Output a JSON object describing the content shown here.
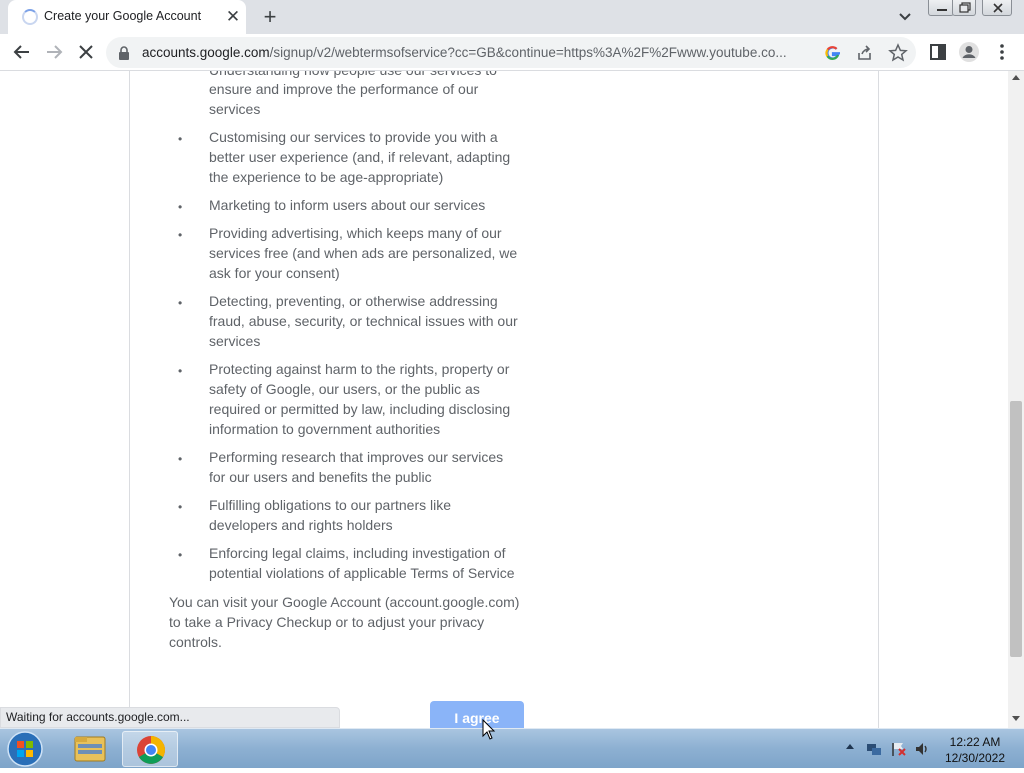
{
  "browser": {
    "tab_title": "Create your Google Account",
    "url_host": "accounts.google.com",
    "url_path": "/signup/v2/webtermsofservice?cc=GB&continue=https%3A%2F%2Fwww.youtube.co..."
  },
  "content": {
    "partial_top_line": "Understanding how people use our services to",
    "items": [
      {
        "lines": [
          "ensure and improve the performance of our",
          "services"
        ]
      },
      {
        "lines": [
          "Customising our services to provide you with a",
          "better user experience (and, if relevant, adapting",
          "the experience to be age-appropriate)"
        ]
      },
      {
        "lines": [
          "Marketing to inform users about our services"
        ]
      },
      {
        "lines": [
          "Providing advertising, which keeps many of our",
          "services free (and when ads are personalized, we",
          "ask for your consent)"
        ]
      },
      {
        "lines": [
          "Detecting, preventing, or otherwise addressing",
          "fraud, abuse, security, or technical issues with our",
          "services"
        ]
      },
      {
        "lines": [
          "Protecting against harm to the rights, property or",
          "safety of Google, our users, or the public as",
          "required or permitted by law, including disclosing",
          "information to government authorities"
        ]
      },
      {
        "lines": [
          "Performing research that improves our services",
          "for our users and benefits the public"
        ]
      },
      {
        "lines": [
          "Fulfilling obligations to our partners like",
          "developers and rights holders"
        ]
      },
      {
        "lines": [
          "Enforcing legal claims, including investigation of",
          "potential violations of applicable Terms of Service"
        ]
      }
    ],
    "privacy_lines": [
      "You can visit your Google Account (account.google.com)",
      "to take a Privacy Checkup or to adjust your privacy",
      "controls."
    ],
    "agree_label": "I agree"
  },
  "status": "Waiting for accounts.google.com...",
  "taskbar": {
    "time": "12:22 AM",
    "date": "12/30/2022"
  },
  "icons": {
    "tab_spinner": "loading-spinner-icon",
    "back": "back-arrow-icon",
    "forward": "forward-arrow-icon",
    "stop": "stop-loading-icon",
    "lock": "lock-icon",
    "google_lens": "google-g-icon",
    "share": "share-icon",
    "bookmark": "star-icon",
    "side_panel": "side-panel-icon",
    "profile": "profile-icon",
    "menu": "kebab-menu-icon"
  },
  "colors": {
    "accent_button": "#8ab4f8",
    "body_text": "#5f6368",
    "tabstrip": "#dee1e6"
  }
}
